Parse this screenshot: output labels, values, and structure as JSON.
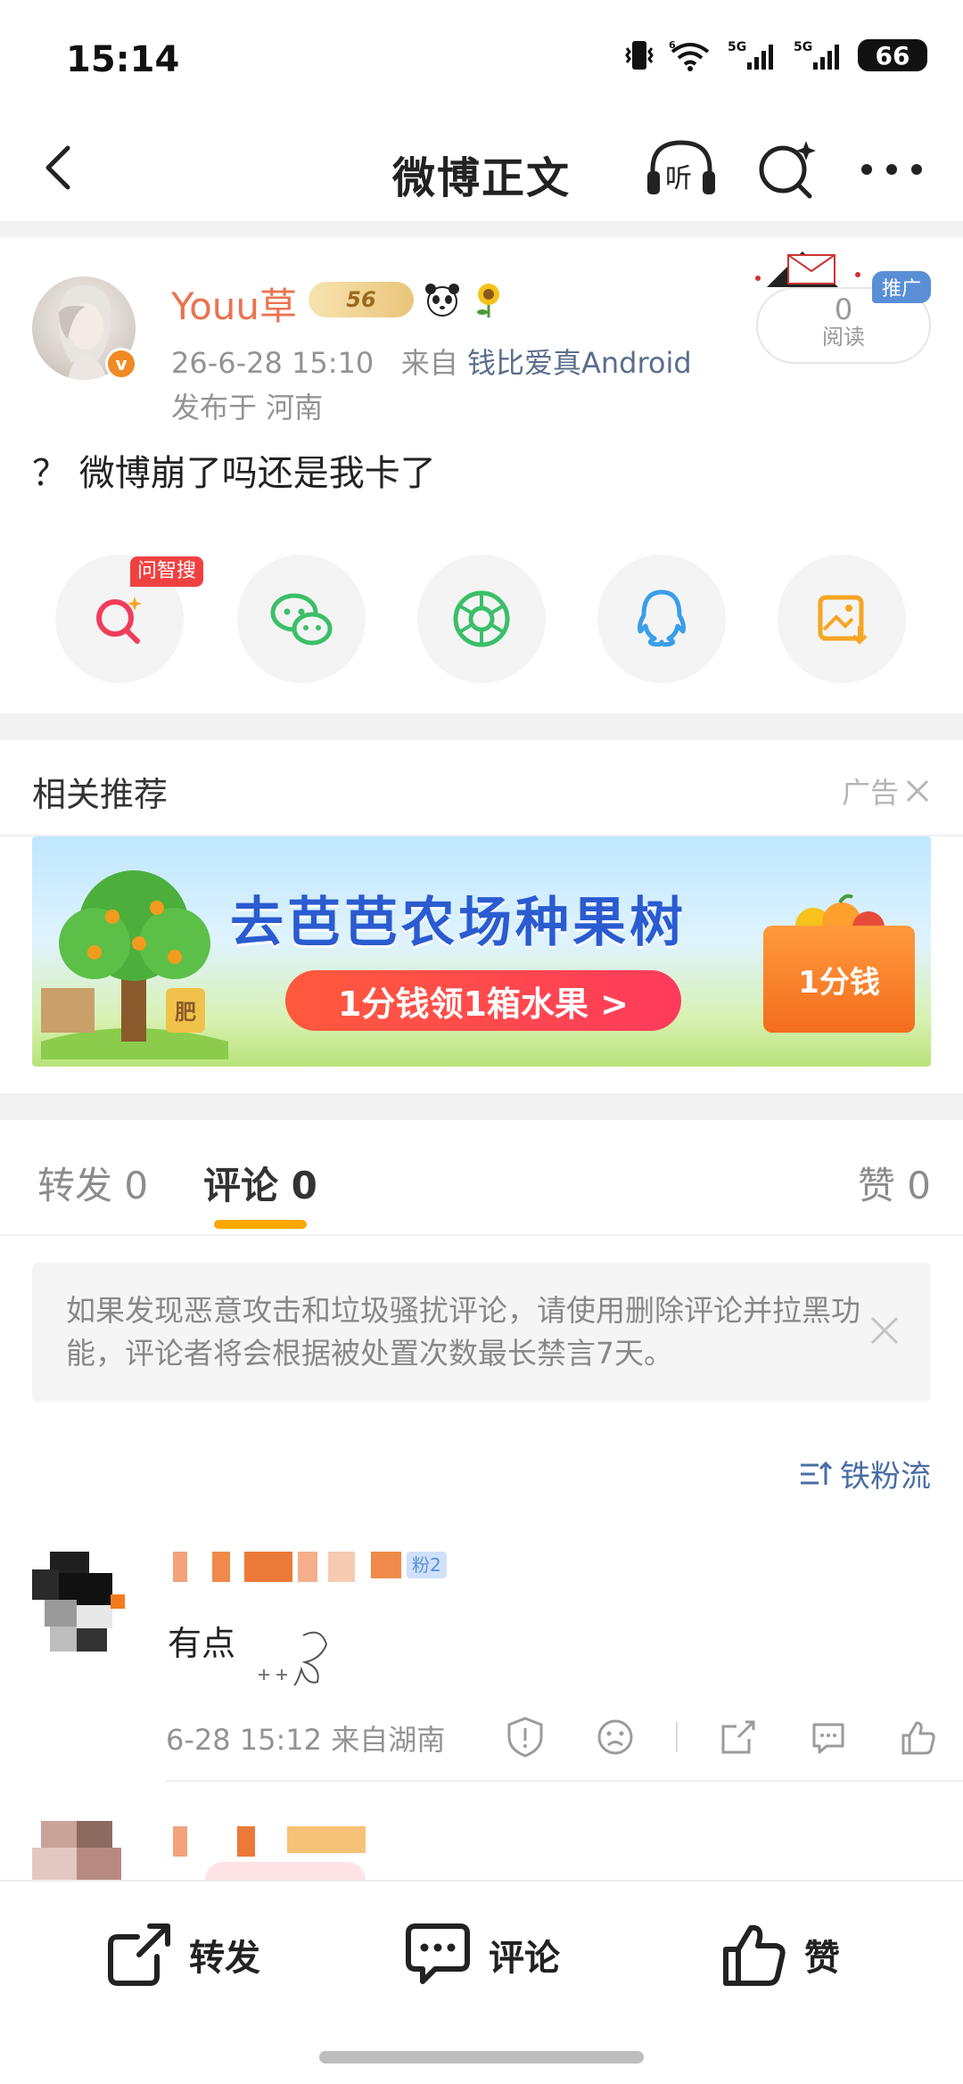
{
  "status_bar": {
    "time": "15:14",
    "battery": "66",
    "net1": "5G",
    "net2": "5G",
    "wifi_sup": "6"
  },
  "nav": {
    "title": "微博正文",
    "listen_label": "听"
  },
  "post": {
    "username": "Youu草",
    "level": "56",
    "date": "26-6-28 15:10",
    "source_prefix": "来自",
    "source": "钱比爱真Android",
    "location": "发布于 河南",
    "read_count": "0",
    "read_label": "阅读",
    "promo_label": "推广",
    "text": "？ 微博崩了吗还是我卡了",
    "share_tag": "问智搜",
    "verified_mark": "v"
  },
  "share_targets": [
    "ai-search",
    "wechat",
    "moments",
    "qq",
    "save-image"
  ],
  "recommend": {
    "title": "相关推荐",
    "ad_label": "广告",
    "banner_title": "去芭芭农场种果树",
    "banner_cta": "1分钱领1箱水果 >",
    "banner_box": "1分钱",
    "banner_pot": "肥"
  },
  "tabs": {
    "repost": "转发 0",
    "comment": "评论 0",
    "like": "赞 0"
  },
  "notice": {
    "text": "如果发现恶意攻击和垃圾骚扰评论，请使用删除评论并拉黑功能，评论者将会根据被处置次数最长禁言7天。"
  },
  "sort_label": "铁粉流",
  "comments": [
    {
      "fan_badge": "粉2",
      "text": "有点",
      "meta": "6-28 15:12 来自湖南"
    }
  ],
  "bottom_bar": {
    "repost": "转发",
    "comment": "评论",
    "like": "赞"
  },
  "colors": {
    "accent": "#eb7350",
    "tab_underline": "#f9a800",
    "link": "#5b6d8c",
    "ad_tag": "#f04141"
  }
}
